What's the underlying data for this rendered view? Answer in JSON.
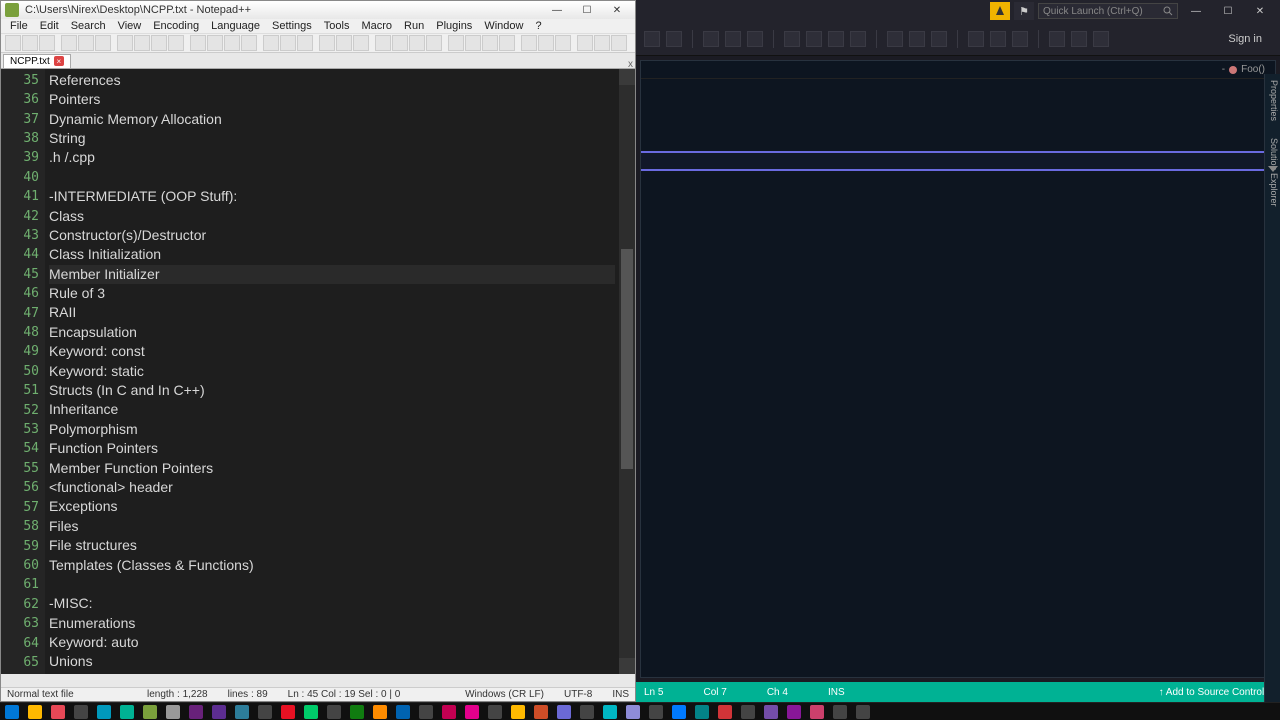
{
  "npp": {
    "title": "C:\\Users\\Nirex\\Desktop\\NCPP.txt - Notepad++",
    "menus": [
      "File",
      "Edit",
      "Search",
      "View",
      "Encoding",
      "Language",
      "Settings",
      "Tools",
      "Macro",
      "Run",
      "Plugins",
      "Window",
      "?"
    ],
    "tab": {
      "label": "NCPP.txt"
    },
    "first_line_no": 35,
    "lines": [
      "References",
      "Pointers",
      "Dynamic Memory Allocation",
      "String",
      ".h /.cpp",
      "",
      "-INTERMEDIATE (OOP Stuff):",
      "Class",
      "Constructor(s)/Destructor",
      "Class Initialization",
      "Member Initializer",
      "Rule of 3",
      "RAII",
      "Encapsulation",
      "Keyword: const",
      "Keyword: static",
      "Structs (In C and In C++)",
      "Inheritance",
      "Polymorphism",
      "Function Pointers",
      "Member Function Pointers",
      "<functional> header",
      "Exceptions",
      "Files",
      "File structures",
      "Templates (Classes & Functions)",
      "",
      "-MISC:",
      "Enumerations",
      "Keyword: auto",
      "Unions"
    ],
    "current_line_index": 10,
    "status": {
      "type": "Normal text file",
      "length": "length : 1,228",
      "lines": "lines : 89",
      "pos": "Ln : 45   Col : 19   Sel : 0 | 0",
      "eol": "Windows (CR LF)",
      "enc": "UTF-8",
      "ins": "INS"
    }
  },
  "vs": {
    "quick_launch": "Quick Launch (Ctrl+Q)",
    "signin": "Sign in",
    "breadcrumb": "Foo()",
    "side_tabs": [
      "Properties",
      "Solution Explorer"
    ],
    "status": {
      "ln": "Ln 5",
      "col": "Col 7",
      "ch": "Ch 4",
      "ins": "INS",
      "src": "↑ Add to Source Control ▴"
    }
  }
}
